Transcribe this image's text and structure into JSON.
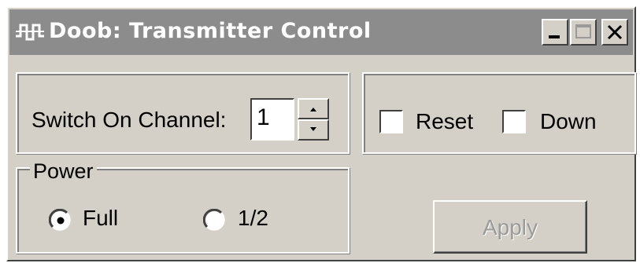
{
  "window": {
    "title": "Doob: Transmitter Control",
    "icon": "waveform-icon",
    "title_bar_color": "#8c8c8c"
  },
  "channel": {
    "label": "Switch On Channel:",
    "value": "1"
  },
  "options": {
    "reset_label": "Reset",
    "reset_checked": false,
    "down_label": "Down",
    "down_checked": false
  },
  "power": {
    "group_label": "Power",
    "options": [
      {
        "label": "Full",
        "selected": true
      },
      {
        "label": "1/2",
        "selected": false
      }
    ]
  },
  "apply": {
    "label": "Apply",
    "enabled": false
  },
  "colors": {
    "face": "#d4d0c8",
    "disabled_text": "#9a9a9a"
  }
}
